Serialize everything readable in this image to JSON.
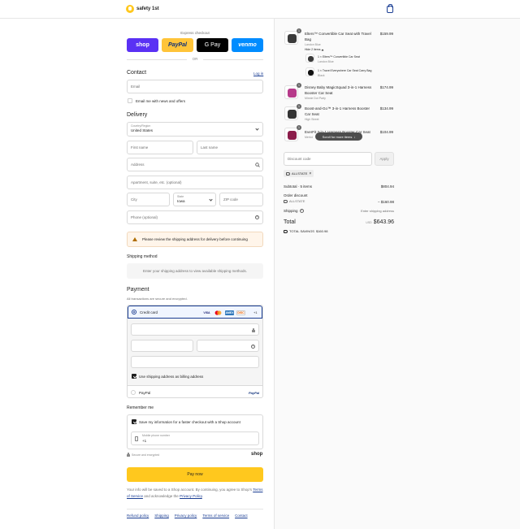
{
  "header": {
    "brand": "safety 1st"
  },
  "express": {
    "title": "Express checkout",
    "shop": "shop",
    "paypal": "PayPal",
    "gpay": "G Pay",
    "venmo": "venmo",
    "or": "OR"
  },
  "contact": {
    "title": "Contact",
    "login": "Log in",
    "email_placeholder": "Email",
    "news_label": "Email me with news and offers"
  },
  "delivery": {
    "title": "Delivery",
    "country_label": "Country/Region",
    "country_value": "United States",
    "first_name": "First name",
    "last_name": "Last name",
    "address": "Address",
    "apartment": "Apartment, suite, etc. (optional)",
    "city": "City",
    "state_label": "State",
    "state_value": "Iowa",
    "zip": "ZIP code",
    "phone": "Phone (optional)",
    "warning": "Please review the shipping address for delivery before continuing"
  },
  "shipping": {
    "title": "Shipping method",
    "info": "Enter your shipping address to view available shipping methods."
  },
  "payment": {
    "title": "Payment",
    "subtitle": "All transactions are secure and encrypted.",
    "credit_card": "Credit card",
    "cards": [
      "VISA",
      "MC",
      "AMEX",
      "DISC"
    ],
    "more_cards": "+1",
    "billing_label": "Use shipping address as billing address",
    "paypal_label": "PayPal",
    "paypal_logo": "PayPal"
  },
  "remember": {
    "title": "Remember me",
    "save_label": "Save my information for a faster checkout with a Shop account",
    "phone_label": "Mobile phone number",
    "phone_value": "+1",
    "secure": "Secure and encrypted",
    "shop_logo": "shop"
  },
  "pay_now": "Pay now",
  "legal": {
    "text1": "Your info will be saved to a Shop account. By continuing, you agree to Shop's ",
    "terms": "Terms of Service",
    "text2": " and acknowledge the ",
    "privacy": "Privacy Policy",
    "text3": "."
  },
  "footer": [
    "Refund policy",
    "Shipping",
    "Privacy policy",
    "Terms of service",
    "Contact"
  ],
  "cart": {
    "items": [
      {
        "qty": "1",
        "title": "Elters™ Convertible Car Seat with Travel Bag",
        "variant": "Landon Blue",
        "price": "$159.99",
        "color": "#3a3a3a"
      },
      {
        "qty": "1",
        "title": "Disney Baby MagicSquad 3-in-1 Harness Booster Car Seat",
        "variant": "Minnie Dot Party",
        "price": "$174.99",
        "color": "#b63a8a"
      },
      {
        "qty": "1",
        "title": "Boost-and-Go™ 3-in-1 Harness Booster Car Seat",
        "variant": "High Street",
        "price": "$134.99",
        "color": "#333333"
      },
      {
        "qty": "1",
        "title": "EverFit 3-in-1 Harness Booster Car Seat",
        "variant": "Merlot",
        "price": "$104.99",
        "color": "#8b1c4a"
      }
    ],
    "hide_items": "Hide 2 items",
    "bundle": [
      {
        "title": "1 × Elters™ Convertible Car Seat",
        "variant": "Landon Blue"
      },
      {
        "title": "1 × Travel Everywhere Car Seat Carry Bag",
        "variant": "Black"
      }
    ],
    "scroll_hint": "Scroll for more items",
    "discount_placeholder": "Discount code",
    "apply": "Apply",
    "applied_code": "ALLSTATE",
    "subtotal_label": "Subtotal · 5 items",
    "subtotal_value": "$804.94",
    "order_discount_label": "Order discount",
    "discount_code": "ALLSTATE",
    "discount_value": "− $160.98",
    "shipping_label": "Shipping",
    "shipping_value": "Enter shipping address",
    "total_label": "Total",
    "currency": "USD",
    "total_value": "$643.96",
    "savings_label": "TOTAL SAVINGS",
    "savings_value": "$160.98"
  }
}
